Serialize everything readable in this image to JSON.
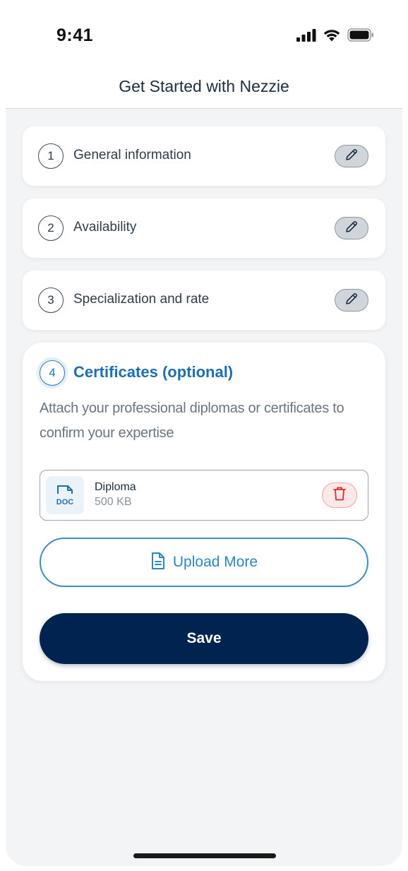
{
  "status_bar": {
    "time": "9:41",
    "icons": [
      "cellular-signal-icon",
      "wifi-icon",
      "battery-icon"
    ]
  },
  "header": {
    "title": "Get Started with Nezzie"
  },
  "steps": [
    {
      "number": "1",
      "label": "General information",
      "action_icon": "pencil-icon"
    },
    {
      "number": "2",
      "label": "Availability",
      "action_icon": "pencil-icon"
    },
    {
      "number": "3",
      "label": "Specialization and rate",
      "action_icon": "pencil-icon"
    }
  ],
  "certificates": {
    "number": "4",
    "title": "Certificates (optional)",
    "description": "Attach your professional diplomas or certificates to confirm your expertise",
    "files": [
      {
        "icon_text": "DOC",
        "name": "Diploma",
        "size": "500 KB",
        "action_icon": "trash-icon"
      }
    ],
    "upload_label": "Upload More",
    "upload_icon": "document-icon",
    "save_label": "Save"
  },
  "colors": {
    "accent_blue": "#1d6fb3",
    "primary_navy": "#00234f",
    "danger_red": "#d92b2b",
    "background": "#f3f4f5"
  }
}
